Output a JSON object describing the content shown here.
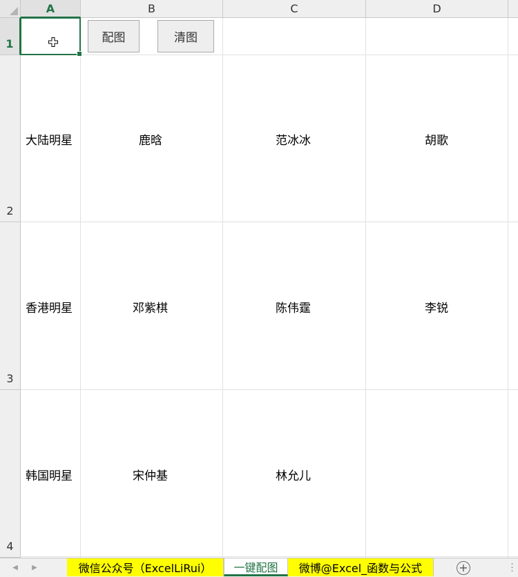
{
  "columns": [
    "A",
    "B",
    "C",
    "D"
  ],
  "rows": [
    "1",
    "2",
    "3",
    "4"
  ],
  "selected_cell": {
    "column": "A",
    "row": "1"
  },
  "buttons": {
    "match_label": "配图",
    "clear_label": "清图"
  },
  "cells": {
    "A2": "大陆明星",
    "B2": "鹿晗",
    "C2": "范冰冰",
    "D2": "胡歌",
    "A3": "香港明星",
    "B3": "邓紫棋",
    "C3": "陈伟霆",
    "D3": "李锐",
    "A4": "韩国明星",
    "B4": "宋仲基",
    "C4": "林允儿"
  },
  "sheet_tabs": [
    {
      "label": "微信公众号（ExcelLiRui）",
      "highlight": "#ffff00"
    },
    {
      "label": "一键配图",
      "active": true
    },
    {
      "label": "微博@Excel_函数与公式",
      "highlight": "#ffff00"
    }
  ],
  "icons": {
    "cursor": "cell-cross-cursor-icon",
    "prev": "scroll-left-icon",
    "next": "scroll-right-icon",
    "add": "add-sheet-icon"
  },
  "colors": {
    "accent": "#217346",
    "tab_highlight": "#ffff00"
  }
}
